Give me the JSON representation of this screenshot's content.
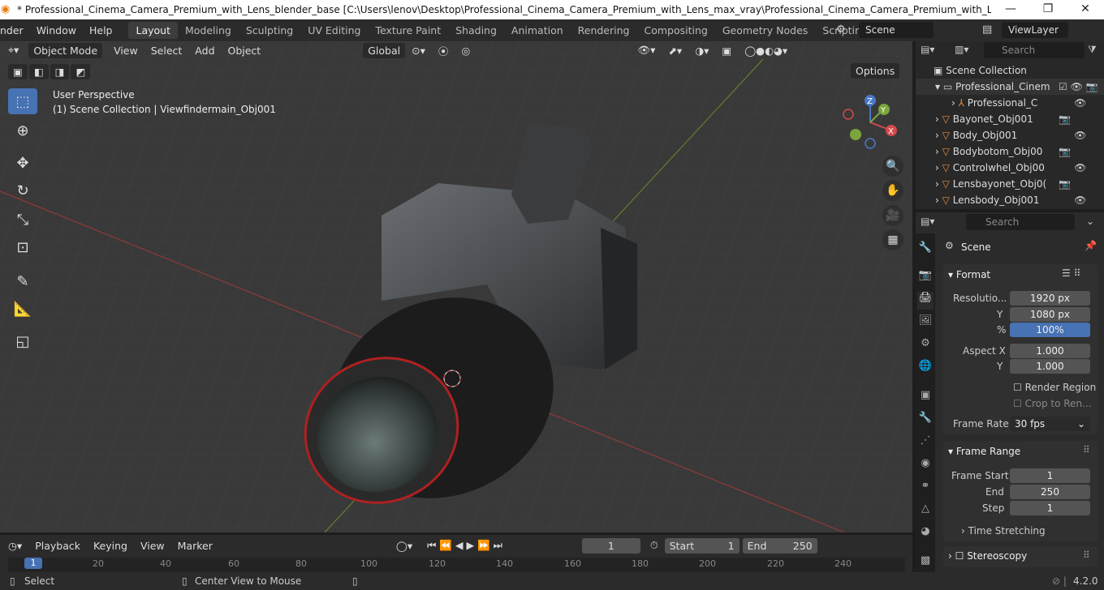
{
  "titlebar": {
    "title": "* Professional_Cinema_Camera_Premium_with_Lens_blender_base [C:\\Users\\lenov\\Desktop\\Professional_Cinema_Camera_Premium_with_Lens_max_vray\\Professional_Cinema_Camera_Premium_with_Lens_blender_base.blen...",
    "minimize": "—",
    "restore": "❐",
    "close": "✕"
  },
  "menu": {
    "render": "nder",
    "window": "Window",
    "help": "Help"
  },
  "workspaces": [
    "Layout",
    "Modeling",
    "Sculpting",
    "UV Editing",
    "Texture Paint",
    "Shading",
    "Animation",
    "Rendering",
    "Compositing",
    "Geometry Nodes",
    "Scripting"
  ],
  "scene": {
    "name": "Scene",
    "view_layer": "ViewLayer"
  },
  "viewport": {
    "mode": "Object Mode",
    "menus": [
      "View",
      "Select",
      "Add",
      "Object"
    ],
    "orientation": "Global",
    "options": "Options",
    "perspective": "User Perspective",
    "collection_info": "(1) Scene Collection | Viewfindermain_Obj001"
  },
  "gizmo": {
    "x": "X",
    "y": "Y",
    "z": "Z"
  },
  "outliner": {
    "search_placeholder": "Search",
    "root": "Scene Collection",
    "rows": [
      "Professional_Cinem",
      "Professional_C",
      "Bayonet_Obj001",
      "Body_Obj001",
      "Bodybotom_Obj00",
      "Controlwhel_Obj00",
      "Lensbayonet_Obj0(",
      "Lensbody_Obj001"
    ]
  },
  "properties": {
    "search_placeholder": "Search",
    "context": "Scene",
    "format_title": "Format",
    "resolution_label": "Resolutio...",
    "res_x": "1920 px",
    "y_label": "Y",
    "res_y": "1080 px",
    "pct_label": "%",
    "res_pct": "100%",
    "aspect_label": "Aspect X",
    "aspect_x": "1.000",
    "aspect_y_label": "Y",
    "aspect_y": "1.000",
    "render_region": "Render Region",
    "crop": "Crop to Ren...",
    "frame_rate_label": "Frame Rate",
    "frame_rate": "30 fps",
    "frame_range_title": "Frame Range",
    "frame_start_label": "Frame Start",
    "frame_start": "1",
    "end_label": "End",
    "end": "250",
    "step_label": "Step",
    "step": "1",
    "time_stretching": "Time Stretching",
    "stereoscopy": "Stereoscopy"
  },
  "timeline": {
    "menus": [
      "Playback",
      "Keying",
      "View",
      "Marker"
    ],
    "current_frame": "1",
    "start_label": "Start",
    "start": "1",
    "end_label": "End",
    "end": "250",
    "ticks": [
      "1",
      "20",
      "40",
      "60",
      "80",
      "100",
      "120",
      "140",
      "160",
      "180",
      "200",
      "220",
      "240"
    ]
  },
  "status": {
    "select": "Select",
    "center": "Center View to Mouse",
    "version": "4.2.0"
  }
}
